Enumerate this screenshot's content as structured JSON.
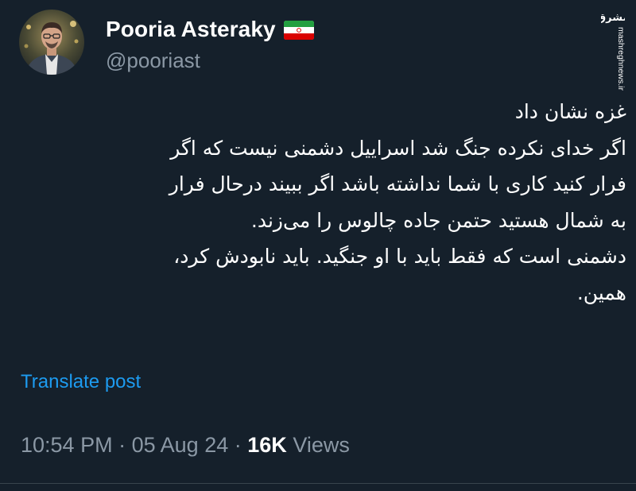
{
  "tweet": {
    "author": {
      "display_name": "Pooria Asteraky",
      "handle": "@pooriast",
      "flag_icon": "iran-flag-icon",
      "avatar_icon": "profile-avatar"
    },
    "text_lines": [
      "غزه نشان داد",
      "اگر خدای نکرده جنگ شد اسراییل دشمنی نیست که اگر",
      "فرار کنید کاری با شما نداشته باشد اگر ببیند درحال فرار",
      "به شمال هستید حتمن جاده چالوس را می‌زند.",
      "دشمنی است که فقط باید با او جنگید. باید نابودش کرد،",
      "همین."
    ],
    "translate_label": "Translate post",
    "time": "10:54 PM",
    "separator": "·",
    "date": "05 Aug 24",
    "views_count": "16K",
    "views_label": "Views"
  },
  "watermark": {
    "logo_text": "مشرق",
    "site_text": "mashreghnews.ir"
  },
  "colors": {
    "background": "#15202b",
    "text": "#ffffff",
    "secondary_text": "#8b98a5",
    "link": "#1d9bf0",
    "divider": "#38444d"
  }
}
